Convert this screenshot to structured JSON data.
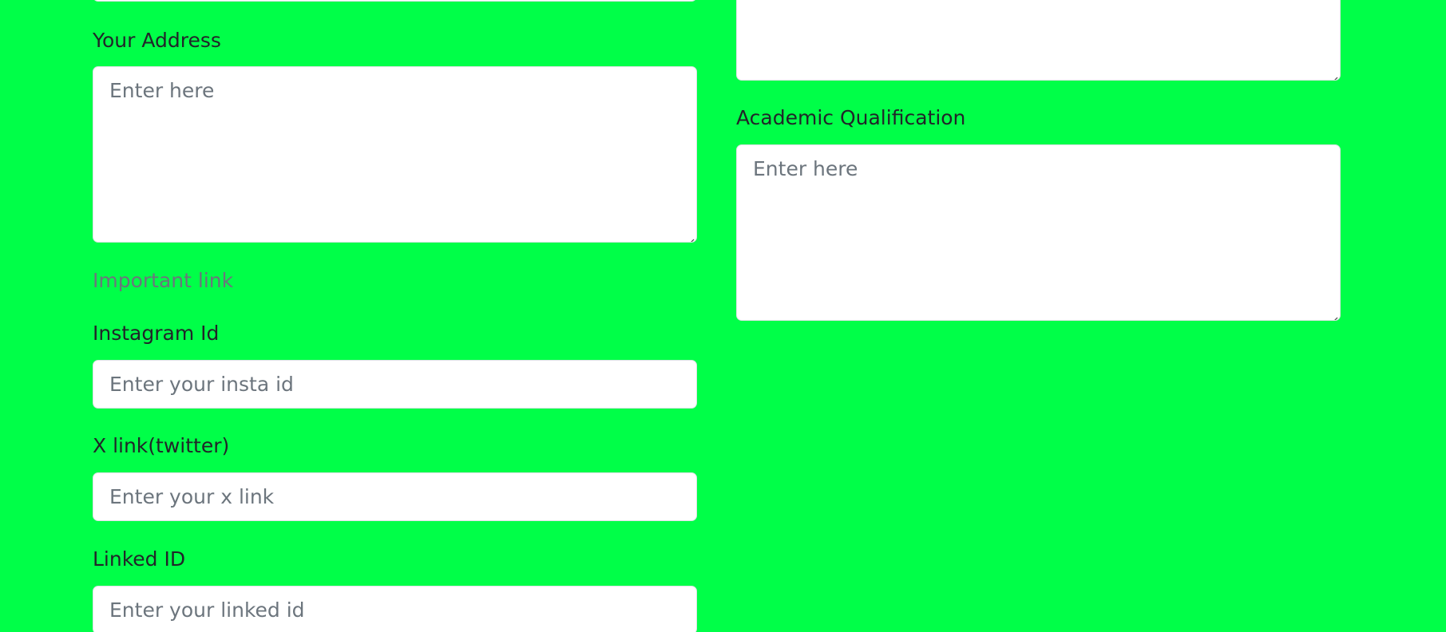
{
  "colors": {
    "background": "#00ff48",
    "field_background": "#ffffff",
    "label_text": "#212529",
    "placeholder_text": "#6c757d",
    "section_heading": "#6c757d"
  },
  "left": {
    "address": {
      "label": "Your Address",
      "placeholder": "Enter here"
    },
    "important_link_heading": "Important link",
    "instagram": {
      "label": "Instagram Id",
      "placeholder": "Enter your insta id"
    },
    "x_link": {
      "label": "X link(twitter)",
      "placeholder": "Enter your x link"
    },
    "linked": {
      "label": "Linked ID",
      "placeholder": "Enter your linked id"
    }
  },
  "right": {
    "academic": {
      "label": "Academic Qualification",
      "placeholder": "Enter here"
    }
  },
  "icons": {
    "resize_handle": "resize-handle-icon"
  }
}
